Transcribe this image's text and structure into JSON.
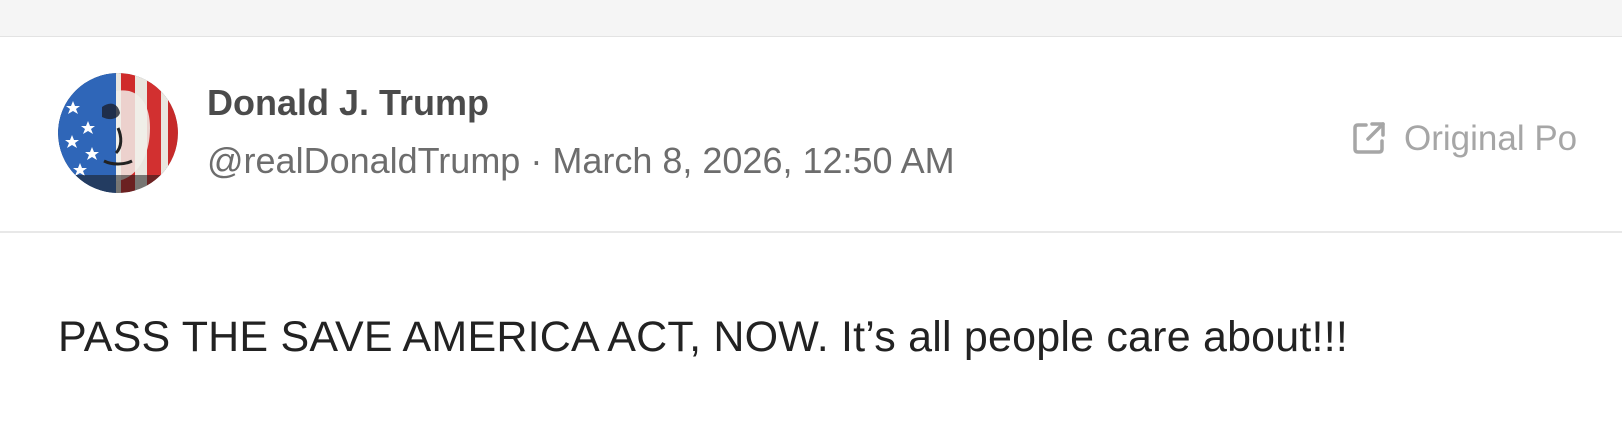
{
  "post": {
    "author_name": "Donald J. Trump",
    "handle": "@realDonaldTrump",
    "separator": " · ",
    "timestamp": "March 8, 2026, 12:50 AM",
    "original_link_label": "Original Po",
    "text": "PASS THE SAVE AMERICA ACT, NOW. It’s all people care about!!!"
  },
  "icons": {
    "avatar": "avatar-flag-portrait",
    "original_link": "external-link-icon"
  },
  "colors": {
    "name": "#4b4b4b",
    "meta": "#6d6d6d",
    "link": "#a6a6a6",
    "body_text": "#222222",
    "divider": "#e8e8e8"
  }
}
